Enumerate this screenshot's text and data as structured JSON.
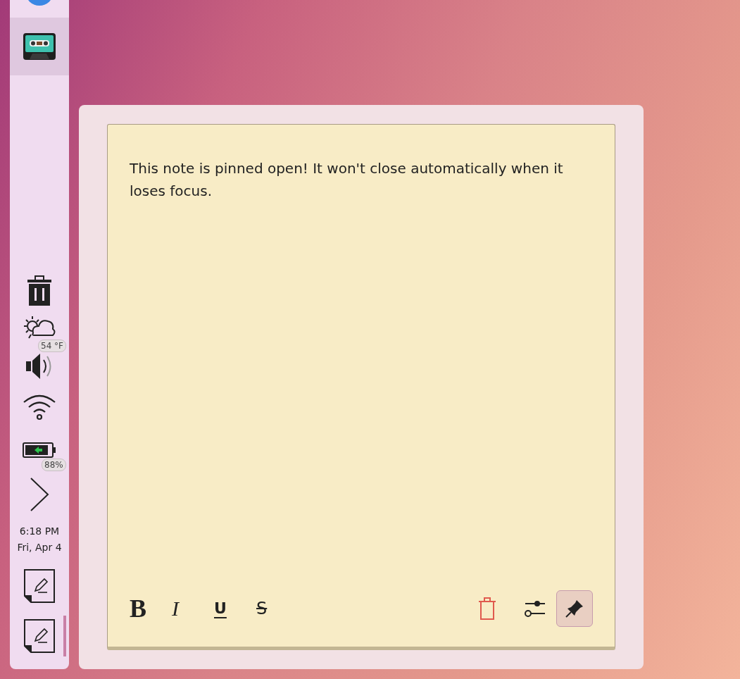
{
  "panel": {
    "launchers": [
      {
        "kind": "globe",
        "selected": false
      },
      {
        "kind": "cassette",
        "selected": true
      }
    ],
    "tray": [
      {
        "kind": "trash"
      },
      {
        "kind": "weather",
        "badge": "54 °F"
      },
      {
        "kind": "volume"
      },
      {
        "kind": "wifi"
      },
      {
        "kind": "battery",
        "badge": "88%"
      },
      {
        "kind": "expand"
      }
    ],
    "clock": {
      "time": "6:18 PM",
      "date": "Fri, Apr 4"
    },
    "notes": [
      {
        "active": false
      },
      {
        "active": true
      }
    ]
  },
  "note": {
    "text": "This note is pinned open! It won't close automatically when it loses focus.",
    "format_buttons": [
      {
        "kind": "bold",
        "label": "B"
      },
      {
        "kind": "italic",
        "label": "I"
      },
      {
        "kind": "underline",
        "label": "U"
      },
      {
        "kind": "strike",
        "label": "S"
      }
    ],
    "pinned": true
  }
}
